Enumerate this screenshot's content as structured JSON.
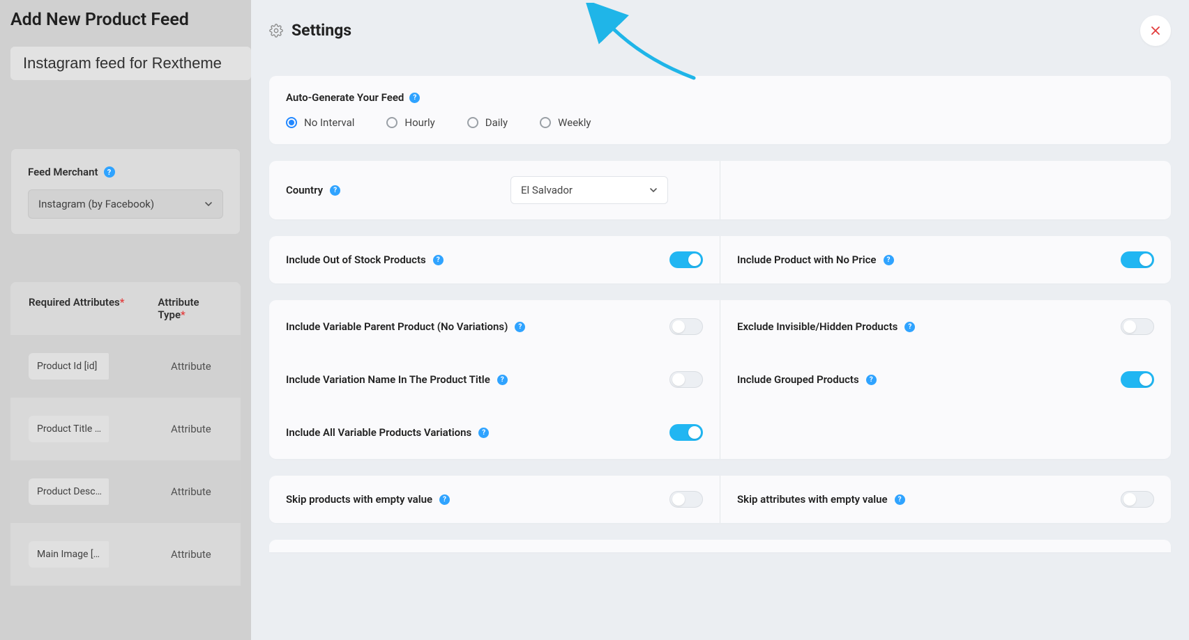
{
  "page_title": "Add New Product Feed",
  "title_input_value": "Instagram feed for Rextheme",
  "merchant": {
    "label": "Feed Merchant",
    "selected": "Instagram (by Facebook)"
  },
  "attr_table": {
    "header_required": "Required Attributes",
    "header_type": "Attribute Type",
    "rows": [
      {
        "chip": "Product Id [id]",
        "type": "Attribute"
      },
      {
        "chip": "Product Title …",
        "type": "Attribute"
      },
      {
        "chip": "Product Desc…",
        "type": "Attribute"
      },
      {
        "chip": "Main Image […",
        "type": "Attribute"
      }
    ]
  },
  "settings": {
    "title": "Settings",
    "auto_generate": {
      "label": "Auto-Generate Your Feed",
      "options": [
        "No Interval",
        "Hourly",
        "Daily",
        "Weekly"
      ],
      "selected": "No Interval"
    },
    "country": {
      "label": "Country",
      "selected": "El Salvador"
    },
    "toggles": {
      "out_of_stock": {
        "label": "Include Out of Stock Products",
        "on": true
      },
      "no_price": {
        "label": "Include Product with No Price",
        "on": true
      },
      "var_parent": {
        "label": "Include Variable Parent Product (No Variations)",
        "on": false
      },
      "exclude_hidden": {
        "label": "Exclude Invisible/Hidden Products",
        "on": false
      },
      "var_name_title": {
        "label": "Include Variation Name In The Product Title",
        "on": false
      },
      "grouped": {
        "label": "Include Grouped Products",
        "on": true
      },
      "all_var": {
        "label": "Include All Variable Products Variations",
        "on": true
      },
      "skip_prod_empty": {
        "label": "Skip products with empty value",
        "on": false
      },
      "skip_attr_empty": {
        "label": "Skip attributes with empty value",
        "on": false
      }
    }
  }
}
